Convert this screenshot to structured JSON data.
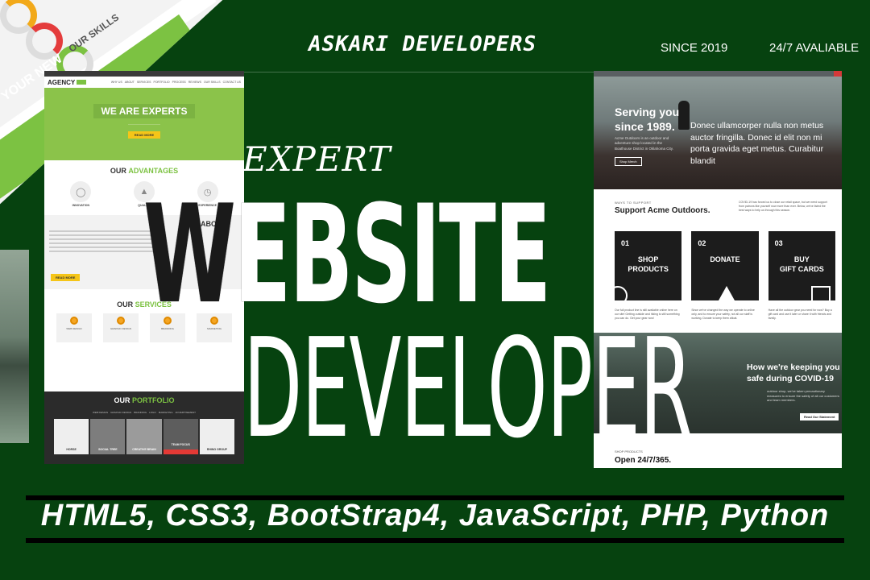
{
  "header": {
    "brand": "ASKARI DEVELOPERS",
    "since": "SINCE 2019",
    "availability": "24/7 AVALIABLE"
  },
  "headline": {
    "kicker": "EXPERT",
    "line1_first_letter": "W",
    "line1_rest": "EBSITE",
    "line2": "DEVELOPER"
  },
  "tech_stack": "HTML5, CSS3, BootStrap4, JavaScript, PHP, Python",
  "top_left_mock": {
    "skills": "OUR SKILLS",
    "your_new": "YOUR NEW"
  },
  "agency_mock": {
    "logo": "AGENCY",
    "menu": [
      "WHY US",
      "ABOUT",
      "SERVICES",
      "PORTFOLIO",
      "PROCESS",
      "REVIEWS",
      "OUR SKILLS",
      "CONTACT US"
    ],
    "hero_title": "WE ARE EXPERTS",
    "hero_button": "READ MORE",
    "advantages_title_a": "OUR ",
    "advantages_title_b": "ADVANTAGES",
    "advantages": [
      "INNOVATION",
      "QUALITY",
      "EXPERIENCE"
    ],
    "about_title": "ABOUT",
    "about_button": "READ MORE",
    "services_title_a": "OUR ",
    "services_title_b": "SERVICES",
    "services": [
      "WEB DESIGN",
      "GRAPHIC DESIGN",
      "BRANDING",
      "MARKETING"
    ],
    "services_link": "VIEW MORE",
    "portfolio_title_a": "OUR ",
    "portfolio_title_b": "PORTFOLIO",
    "portfolio_tabs": [
      "WEB DESIGN",
      "GRAPHIC DESIGN",
      "BRANDING",
      "LOGO",
      "MARKETING",
      "ADVERTISEMENT"
    ],
    "portfolio_items": [
      "HORSE",
      "SOCIAL TREE",
      "CREATIVE BRAIN",
      "TEAM FOCUS",
      "RHINO GROUP"
    ]
  },
  "acme_mock": {
    "hero_title_1": "Serving you",
    "hero_title_2": "since 1989.",
    "hero_sub": "Acme Outdoors is an outdoor and adventure shop located in the Boathouse District in Oklahoma City.",
    "hero_button": "Shop Merch",
    "overlay_text": "Donec ullamcorper nulla non metus auctor fringilla. Donec id elit non mi porta gravida  eget metus. Curabitur blandit",
    "support_kicker": "WAYS TO SUPPORT",
    "support_title": "Support Acme Outdoors.",
    "support_text": "COVID-19 has forced us to close our retail space, but we need support from patrons like yourself now more than ever. Below, we've listed the best ways to help us through this season.",
    "cards": [
      {
        "num": "01",
        "label_1": "SHOP",
        "label_2": "PRODUCTS"
      },
      {
        "num": "02",
        "label_1": "DONATE",
        "label_2": ""
      },
      {
        "num": "03",
        "label_1": "BUY",
        "label_2": "GIFT CARDS"
      }
    ],
    "card_texts": [
      "Our full product line is still available online here on our site! Getting outside and hiking is still something you can do. Get your gear now!",
      "Since we've changed the way we operate to online only, and to ensure your safety, not all our staff is working. Donate to keep them afloat.",
      "Have all the outdoor gear you need for now? Buy a gift card and use it later or share it with friends and family."
    ],
    "covid_title_1": "How we're keeping you",
    "covid_title_2": "safe during COVID-19",
    "covid_text": "outdoor shop, we've taken precautionary measures to ensure the safety of all our customers and team members.",
    "covid_button": "Read Our Statement",
    "bottom_kicker": "SHOP PRODUCTS",
    "bottom_title": "Open 24/7/365."
  }
}
